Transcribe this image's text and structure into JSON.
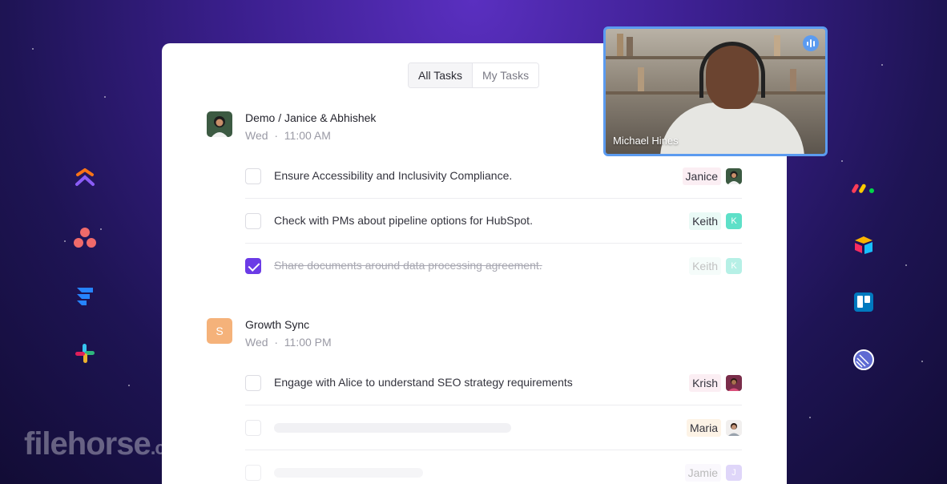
{
  "tabs": [
    {
      "label": "All Tasks",
      "active": true
    },
    {
      "label": "My Tasks",
      "active": false
    }
  ],
  "meetings": [
    {
      "title": "Demo / Janice & Abhishek",
      "day": "Wed",
      "sep": "·",
      "time": "11:00 AM",
      "avatar_letter": "",
      "tasks": [
        {
          "text": "Ensure Accessibility and Inclusivity Compliance.",
          "done": false,
          "assignee": "Janice",
          "avatar_letter": ""
        },
        {
          "text": "Check with PMs about pipeline options for HubSpot.",
          "done": false,
          "assignee": "Keith",
          "avatar_letter": "K"
        },
        {
          "text": "Share documents around data processing agreement.",
          "done": true,
          "assignee": "Keith",
          "avatar_letter": "K"
        }
      ]
    },
    {
      "title": "Growth Sync",
      "day": "Wed",
      "sep": "·",
      "time": "11:00 PM",
      "avatar_letter": "S",
      "tasks": [
        {
          "text": "Engage with Alice to understand SEO strategy requirements",
          "done": false,
          "assignee": "Krish",
          "avatar_letter": ""
        },
        {
          "text": "",
          "done": false,
          "assignee": "Maria",
          "avatar_letter": ""
        },
        {
          "text": "",
          "done": false,
          "assignee": "Jamie",
          "avatar_letter": "J"
        }
      ]
    }
  ],
  "video": {
    "participant": "Michael Hines"
  },
  "left_apps": [
    "clickup-icon",
    "asana-icon",
    "jira-icon",
    "slack-icon"
  ],
  "right_apps": [
    "monday-icon",
    "airtable-icon",
    "trello-icon",
    "linear-icon"
  ],
  "watermark": {
    "main": "filehorse",
    "suffix": ".com"
  },
  "colors": {
    "accent": "#6b3be6",
    "video_border": "#5b9bf0",
    "keith": "#5ee0c8",
    "growth_avatar": "#f5b27a"
  }
}
